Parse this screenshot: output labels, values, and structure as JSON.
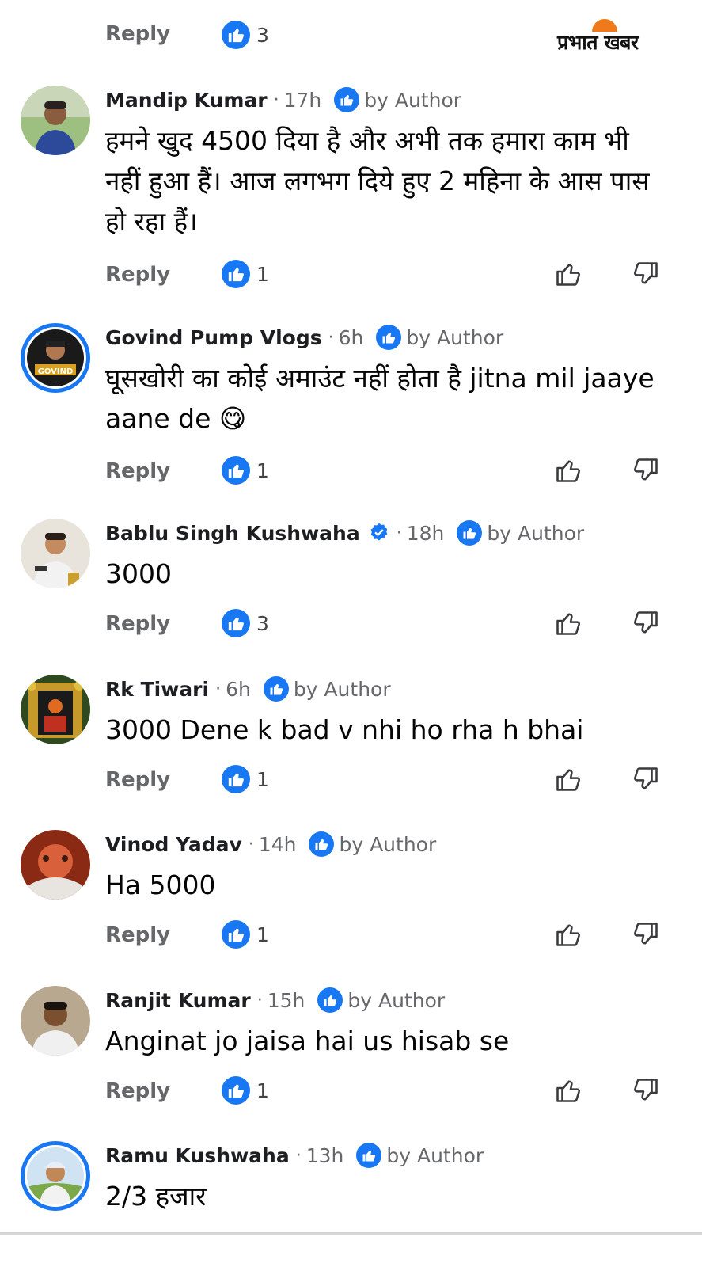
{
  "top": {
    "reply_label": "Reply",
    "like_count": "3",
    "logo_text": "प्रभात खबर"
  },
  "comments": [
    {
      "author": "Mandip Kumar",
      "time": "17h",
      "by_author": "by Author",
      "text": "हमने खुद 4500 दिया है और अभी तक हमारा काम भी नहीं हुआ हैं। आज लगभग दिये हुए 2 महिना के आस पास हो रहा हैं।",
      "reply_label": "Reply",
      "like_count": "1"
    },
    {
      "author": "Govind Pump Vlogs",
      "time": "6h",
      "by_author": "by Author",
      "text": "घूसखोरी का कोई अमाउंट नहीं होता है  jitna mil jaaye aane de 😋",
      "reply_label": "Reply",
      "like_count": "1",
      "avatar_text": "GOVIND"
    },
    {
      "author": "Bablu Singh Kushwaha",
      "time": "18h",
      "by_author": "by Author",
      "verified": true,
      "text": "3000",
      "reply_label": "Reply",
      "like_count": "3"
    },
    {
      "author": "Rk Tiwari",
      "time": "6h",
      "by_author": "by Author",
      "text": "3000 Dene k bad v nhi ho rha h bhai",
      "reply_label": "Reply",
      "like_count": "1"
    },
    {
      "author": "Vinod Yadav",
      "time": "14h",
      "by_author": "by Author",
      "text": "Ha 5000",
      "reply_label": "Reply",
      "like_count": "1"
    },
    {
      "author": "Ranjit Kumar",
      "time": "15h",
      "by_author": "by Author",
      "text": "Anginat jo jaisa hai us hisab se",
      "reply_label": "Reply",
      "like_count": "1"
    },
    {
      "author": "Ramu Kushwaha",
      "time": "13h",
      "by_author": "by Author",
      "text": "2/3 हजार"
    }
  ],
  "colors": {
    "accent": "#1877f2",
    "muted": "#65676b",
    "logo_sun": "#f07a1a"
  },
  "icons": [
    "like-icon",
    "thumbs-up-icon",
    "thumbs-down-icon",
    "verified-badge-icon",
    "author-like-icon"
  ]
}
